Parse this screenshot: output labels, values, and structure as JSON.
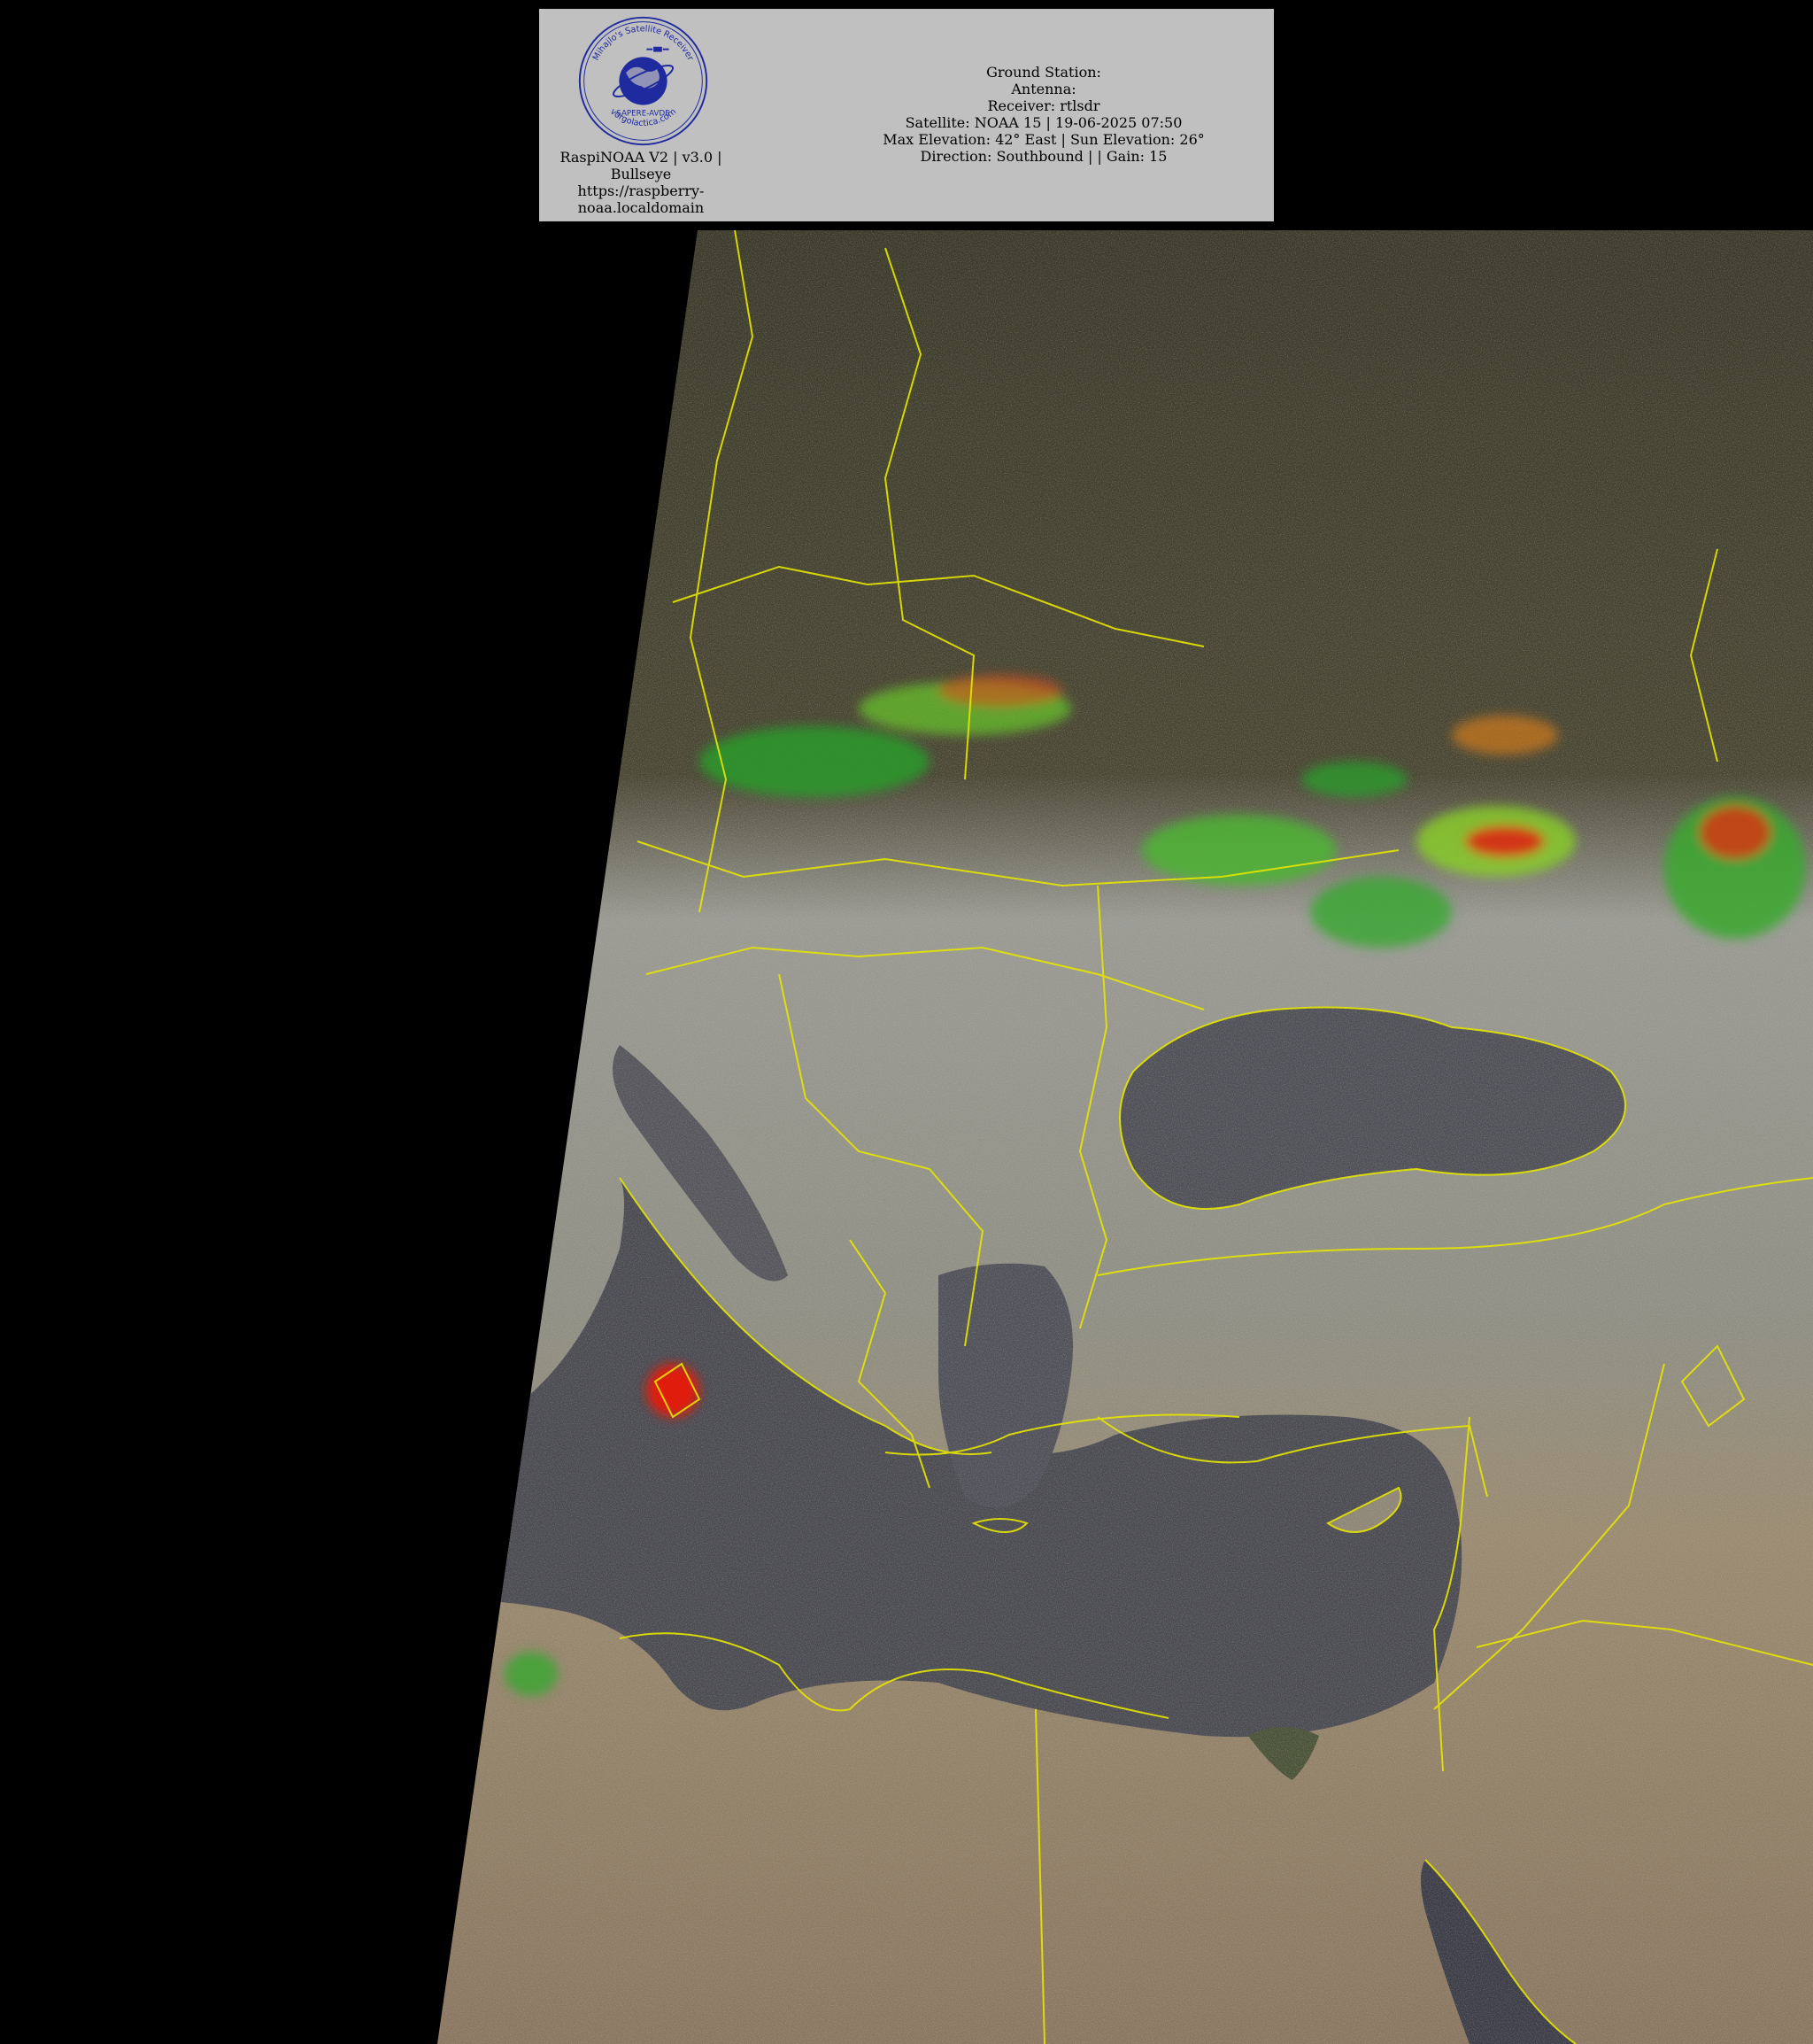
{
  "logo": {
    "ring_text_top": "Mihajlo's Satellite Receiver",
    "ring_text_bottom": "vorgolactica.com",
    "callsign": "SAPERE-AVDE",
    "icon": "globe-satellite-icon"
  },
  "caption": {
    "line1": "RaspiNOAA V2 | v3.0 |",
    "line2": "Bullseye",
    "line3": "https://raspberry-",
    "line4": "noaa.localdomain"
  },
  "info": {
    "ground_station": "Ground Station:",
    "antenna": "Antenna:",
    "receiver": "Receiver: rtlsdr",
    "satellite": "Satellite: NOAA 15 | 19-06-2025 07:50",
    "elevation": "Max Elevation: 42° East | Sun Elevation: 26°",
    "direction": "Direction: Southbound | | Gain: 15"
  },
  "colors": {
    "header_bg": "#c0c0c0",
    "border_lines": "#e6e600",
    "sea": "#4a4a52",
    "land_desert": "#9c8466",
    "land_grey": "#8e8e86",
    "noise_land": "#3e3a2a",
    "cloud_green": "#2f9f2f",
    "cloud_red": "#e02010",
    "logo_blue": "#1e2a9e"
  }
}
